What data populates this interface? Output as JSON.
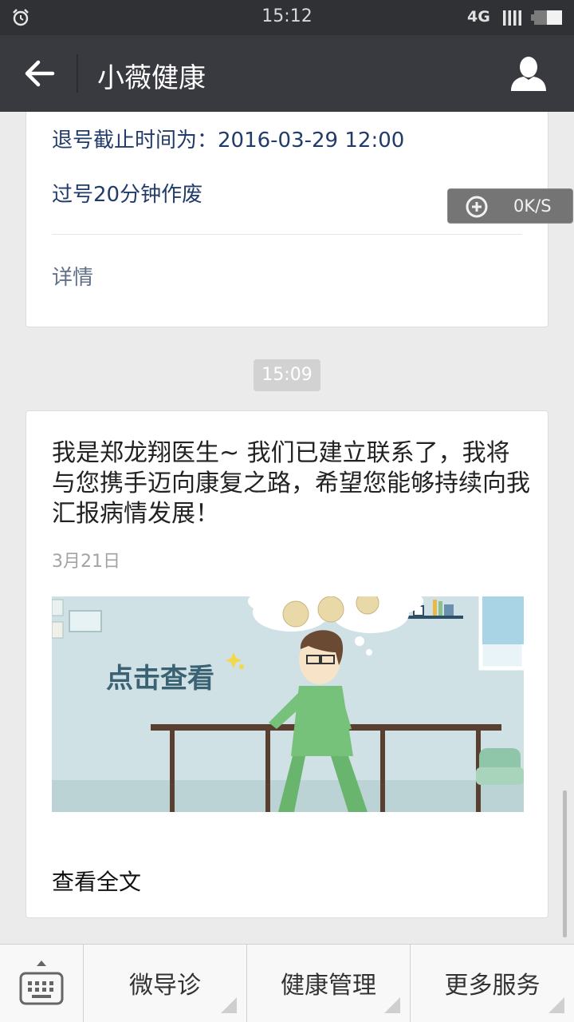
{
  "status_bar": {
    "time": "15:12",
    "network": "4G",
    "icons": [
      "alarm-icon",
      "signal-icon",
      "battery-icon"
    ]
  },
  "navbar": {
    "title": "小薇健康",
    "back_icon": "arrow-left-icon",
    "profile_icon": "user-icon"
  },
  "appointment_card": {
    "deadline": "退号截止时间为：2016-03-29 12:00",
    "expire_note": "过号20分钟作废",
    "detail_link": "详情"
  },
  "speed_overlay": {
    "value": "0K/S"
  },
  "timestamp": "15:09",
  "article_card": {
    "message": "我是郑龙翔医生~ 我们已建立联系了，我将与您携手迈向康复之路，希望您能够持续向我汇报病情发展！",
    "date": "3月21日",
    "cover_text": "点击查看",
    "read_all": "查看全文"
  },
  "bottom_menu": {
    "keyboard_icon": "keyboard-icon",
    "items": [
      {
        "label": "微导诊"
      },
      {
        "label": "健康管理"
      },
      {
        "label": "更多服务"
      }
    ]
  },
  "colors": {
    "navbar": "#393a3f",
    "status_bar": "#2f3134",
    "link_blue": "#213c6a",
    "background": "#ebebeb"
  }
}
